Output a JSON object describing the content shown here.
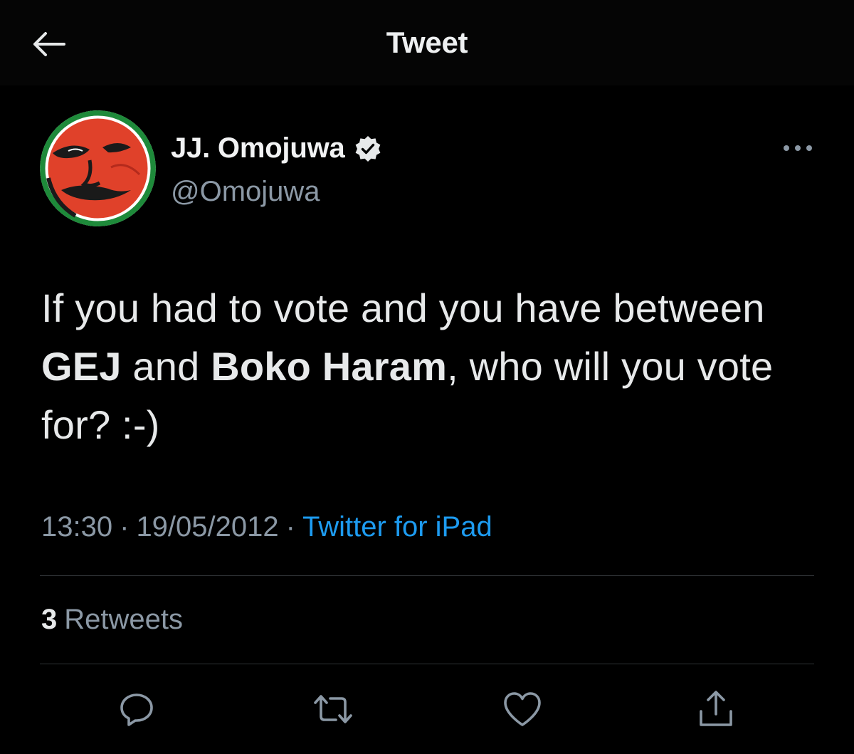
{
  "header": {
    "title": "Tweet",
    "back_icon": "arrow-left-icon"
  },
  "author": {
    "display_name": "JJ. Omojuwa",
    "handle": "@Omojuwa",
    "verified": true,
    "verified_icon": "verified-badge-icon",
    "avatar": "avatar-image"
  },
  "tweet": {
    "segments": [
      {
        "text": "If you had to vote and you have between ",
        "bold": false
      },
      {
        "text": "GEJ",
        "bold": true
      },
      {
        "text": " and ",
        "bold": false
      },
      {
        "text": "Boko Haram",
        "bold": true
      },
      {
        "text": ", who will you vote for? :-)",
        "bold": false
      }
    ],
    "time": "13:30",
    "date": "19/05/2012",
    "separator": "·",
    "source": "Twitter for iPad"
  },
  "stats": {
    "retweets_count": "3",
    "retweets_label": "Retweets"
  },
  "actions": [
    {
      "name": "reply",
      "icon": "reply-icon"
    },
    {
      "name": "retweet",
      "icon": "retweet-icon"
    },
    {
      "name": "like",
      "icon": "heart-icon"
    },
    {
      "name": "share",
      "icon": "share-icon"
    }
  ],
  "colors": {
    "background": "#000000",
    "text_primary": "#e7e9ea",
    "text_secondary": "#8b98a5",
    "link": "#1d9bf0",
    "divider": "#2f3336"
  }
}
